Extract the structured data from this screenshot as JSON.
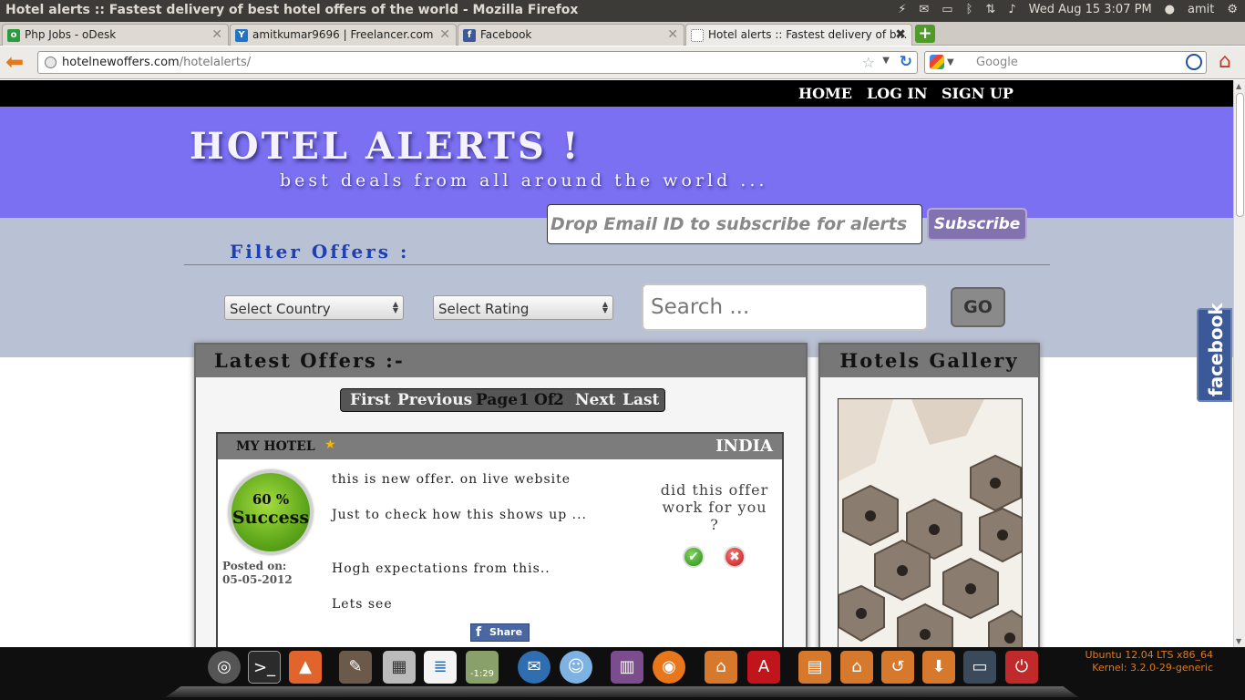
{
  "os": {
    "window_title": "Hotel alerts :: Fastest delivery of best hotel offers of the world - Mozilla Firefox",
    "clock": "Wed Aug 15  3:07 PM",
    "user": "amit"
  },
  "browser": {
    "tabs": [
      {
        "label": "Php Jobs - oDesk",
        "favicon": "odesk-icon",
        "color": "#2b9b3e"
      },
      {
        "label": "amitkumar9696 | Freelancer.com",
        "favicon": "freelancer-icon",
        "color": "#1f74c4"
      },
      {
        "label": "Facebook",
        "favicon": "facebook-icon",
        "color": "#3b5998"
      },
      {
        "label": "Hotel alerts :: Fastest delivery of b…",
        "favicon": "blank-page-icon",
        "color": "#ffffff"
      }
    ],
    "url_domain": "hotelnewoffers.com",
    "url_path": "/hotelalerts/",
    "search_placeholder": "Google"
  },
  "site": {
    "nav": [
      "HOME",
      "LOG IN",
      "SIGN UP"
    ],
    "brand": "HOTEL ALERTS !",
    "tagline": "best deals from all around the world ...",
    "subscribe_placeholder": "Drop Email ID to subscribe for alerts",
    "subscribe_label": "Subscribe",
    "filter_title": "Filter Offers :",
    "country_select": "Select Country",
    "rating_select": "Select Rating",
    "search_placeholder": "Search ...",
    "go_label": "GO",
    "facebook_tab": "facebook"
  },
  "offers": {
    "title": "Latest Offers :-",
    "pager": {
      "first": "First",
      "previous": "Previous",
      "page_word": "Page",
      "page": "1",
      "of_word": "Of",
      "total": "2",
      "next": "Next",
      "last": "Last"
    },
    "card": {
      "hotel": "MY HOTEL",
      "country": "INDIA",
      "success_pct": "60 %",
      "success_label": "Success",
      "posted_label": "Posted on:",
      "posted_date": "05-05-2012",
      "lines": [
        "this is new offer. on live website",
        "Just to check how this shows up ...",
        "Hogh expectations from this..",
        "Lets see"
      ],
      "vote_question": "did this offer work for you ?",
      "share_label": "Share"
    }
  },
  "gallery": {
    "title": "Hotels Gallery"
  },
  "dock": {
    "timer": "-1:29",
    "sysinfo_line1": "Ubuntu 12.04 LTS  x86_64",
    "sysinfo_line2": "Kernel: 3.2.0-29-generic"
  }
}
